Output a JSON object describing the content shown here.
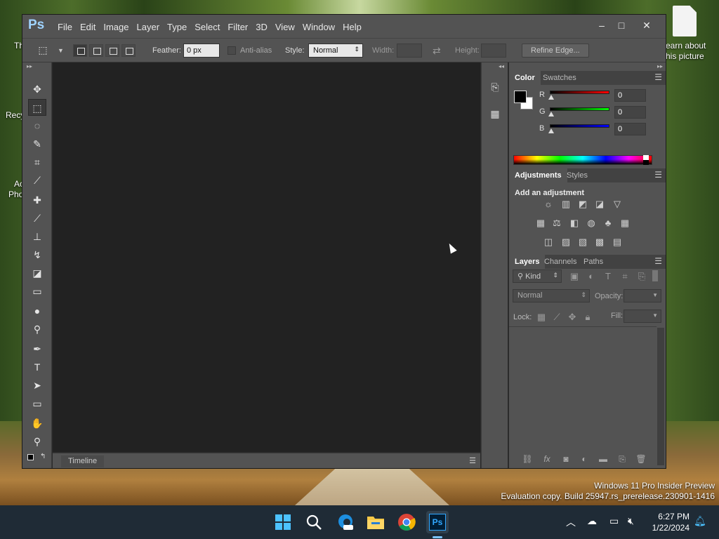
{
  "desktop": {
    "left_icons": [
      "Th",
      "Recy",
      "Ac",
      "Pho"
    ],
    "right_icon_caption": "earn about\nhis picture",
    "watermark_line1": "Windows 11 Pro Insider Preview",
    "watermark_line2": "Evaluation copy. Build 25947.rs_prerelease.230901-1416"
  },
  "photoshop": {
    "logo": "Ps",
    "menu": [
      "File",
      "Edit",
      "Image",
      "Layer",
      "Type",
      "Select",
      "Filter",
      "3D",
      "View",
      "Window",
      "Help"
    ],
    "window_controls": {
      "minimize": "–",
      "maximize": "□",
      "close": "✕"
    },
    "options": {
      "feather_label": "Feather:",
      "feather_value": "0 px",
      "antialias_label": "Anti-alias",
      "style_label": "Style:",
      "style_value": "Normal",
      "width_label": "Width:",
      "height_label": "Height:",
      "refine_edge": "Refine Edge..."
    },
    "timeline_tab": "Timeline",
    "color_panel": {
      "tabs": [
        "Color",
        "Swatches"
      ],
      "channels": [
        {
          "label": "R",
          "value": "0",
          "color": "#ff0000"
        },
        {
          "label": "G",
          "value": "0",
          "color": "#00ff00"
        },
        {
          "label": "B",
          "value": "0",
          "color": "#0000ff"
        }
      ],
      "foreground": "#000000",
      "background": "#ffffff"
    },
    "adjustments_panel": {
      "tabs": [
        "Adjustments",
        "Styles"
      ],
      "title": "Add an adjustment"
    },
    "layers_panel": {
      "tabs": [
        "Layers",
        "Channels",
        "Paths"
      ],
      "kind": "Kind",
      "blend_mode": "Normal",
      "opacity_label": "Opacity:",
      "lock_label": "Lock:",
      "fill_label": "Fill:"
    }
  },
  "taskbar": {
    "time": "6:27 PM",
    "date": "1/22/2024",
    "apps": [
      "start-icon",
      "search-icon",
      "edge-pre-icon",
      "file-explorer-icon",
      "chrome-icon",
      "photoshop-icon"
    ]
  }
}
